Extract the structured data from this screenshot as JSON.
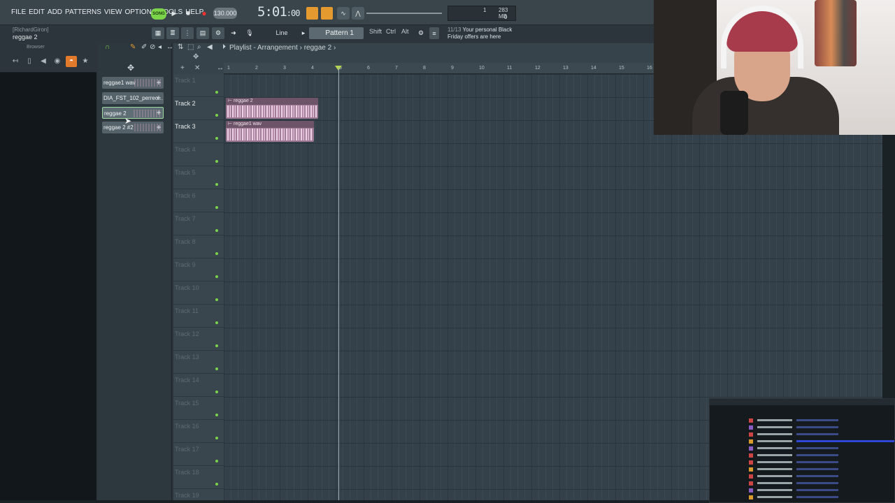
{
  "menu": [
    "FILE",
    "EDIT",
    "ADD",
    "PATTERNS",
    "VIEW",
    "OPTIONS",
    "TOOLS",
    "HELP"
  ],
  "transport": {
    "song_label": "SONG",
    "bpm": "130.000",
    "time_main": "5:01",
    "time_sub": ":00"
  },
  "cpu": {
    "voices": "1",
    "memory": "283 MB",
    "zero": "0"
  },
  "hint": {
    "line1": "[RichardGiron]",
    "line2": "reggae 2"
  },
  "toolbar": {
    "snap": "Line",
    "pattern": "Pattern 1",
    "shift": "Shift",
    "ctrl": "Ctrl",
    "alt": "Alt"
  },
  "news": {
    "count": "11/13",
    "line1": "Your personal Black",
    "line2": "Friday offers are here"
  },
  "browser": {
    "title": "Browser"
  },
  "picker": {
    "items": [
      "reggae1 wav",
      "DIA_FST_102_perreo...",
      "reggae 2",
      "reggae 2 #2"
    ]
  },
  "playlist": {
    "title": "Playlist - Arrangement",
    "breadcrumb": "reggae 2",
    "ruler": [
      "1",
      "2",
      "3",
      "4",
      "5",
      "6",
      "7",
      "8",
      "9",
      "10",
      "11",
      "12",
      "13",
      "14",
      "15",
      "16"
    ],
    "tracks": [
      "Track 1",
      "Track 2",
      "Track 3",
      "Track 4",
      "Track 5",
      "Track 6",
      "Track 7",
      "Track 8",
      "Track 9",
      "Track 10",
      "Track 11",
      "Track 12",
      "Track 13",
      "Track 14",
      "Track 15",
      "Track 16",
      "Track 17",
      "Track 18",
      "Track 19"
    ],
    "clips": [
      {
        "label": "reggae 2"
      },
      {
        "label": "reggae1 wav"
      }
    ]
  },
  "colors": {
    "accent_green": "#7bd44a",
    "accent_orange": "#e49a2f",
    "clip": "#9f7b97"
  }
}
